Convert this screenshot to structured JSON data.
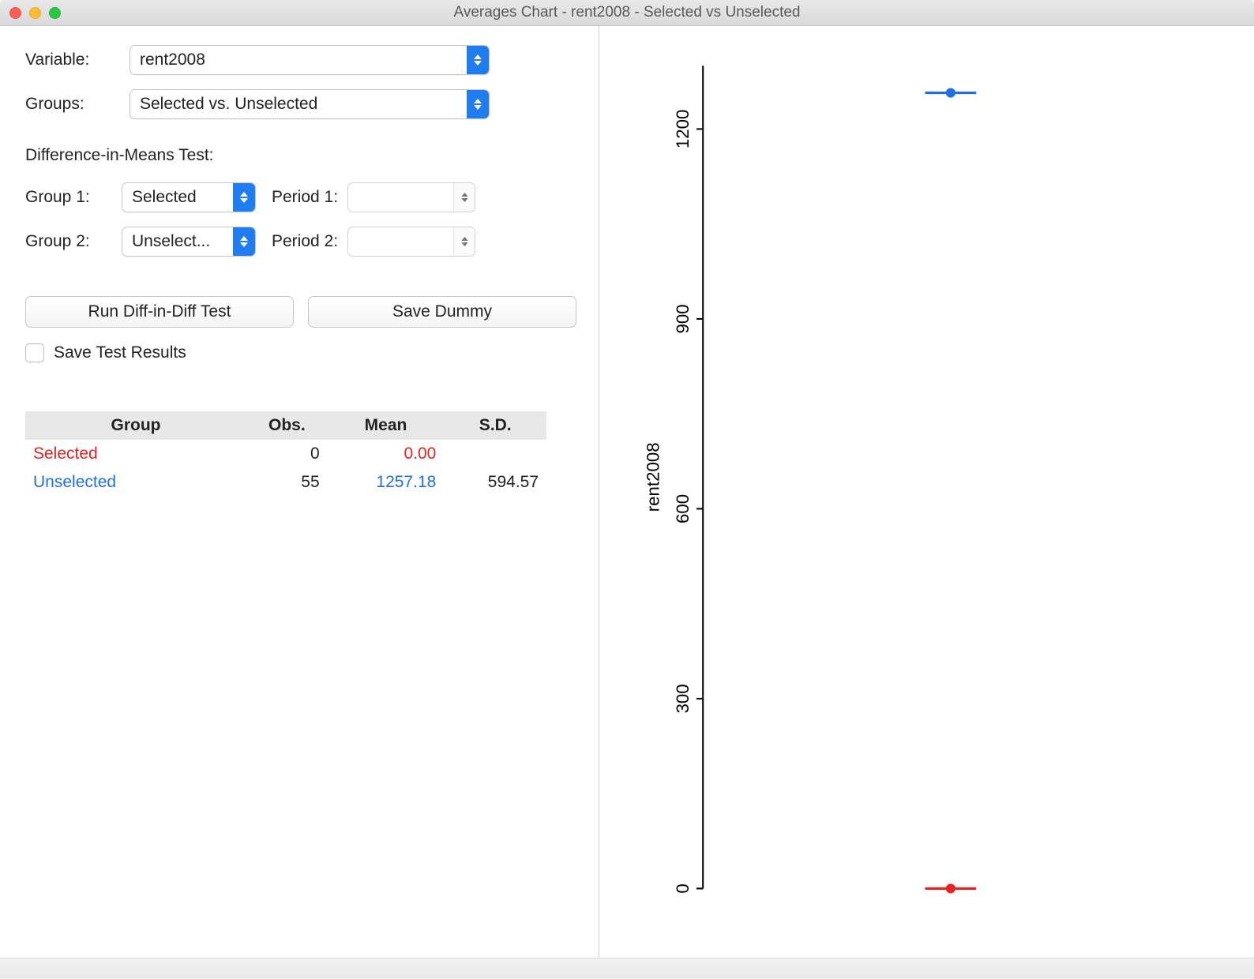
{
  "window": {
    "title": "Averages Chart - rent2008 - Selected vs Unselected"
  },
  "controls": {
    "variable_label": "Variable:",
    "variable_value": "rent2008",
    "groups_label": "Groups:",
    "groups_value": "Selected vs. Unselected",
    "diff_header": "Difference-in-Means Test:",
    "group1_label": "Group 1:",
    "group1_value": "Selected",
    "period1_label": "Period 1:",
    "period1_value": "",
    "group2_label": "Group 2:",
    "group2_value": "Unselect...",
    "period2_label": "Period 2:",
    "period2_value": "",
    "run_btn": "Run Diff-in-Diff Test",
    "save_dummy_btn": "Save Dummy",
    "save_results_label": "Save Test Results"
  },
  "table": {
    "headers": {
      "group": "Group",
      "obs": "Obs.",
      "mean": "Mean",
      "sd": "S.D."
    },
    "rows": [
      {
        "group": "Selected",
        "obs": "0",
        "mean": "0.00",
        "sd": "",
        "class": "red-text"
      },
      {
        "group": "Unselected",
        "obs": "55",
        "mean": "1257.18",
        "sd": "594.57",
        "class": "blue-text"
      }
    ]
  },
  "chart_data": {
    "type": "scatter",
    "ylabel": "rent2008",
    "ylim": [
      0,
      1300
    ],
    "yticks": [
      0,
      300,
      600,
      900,
      1200
    ],
    "series": [
      {
        "name": "Unselected",
        "color": "#1f6fe0",
        "x": 0,
        "y": 1257.18,
        "err": 60
      },
      {
        "name": "Selected",
        "color": "#e62222",
        "x": 0,
        "y": 0,
        "err": 30
      }
    ]
  }
}
